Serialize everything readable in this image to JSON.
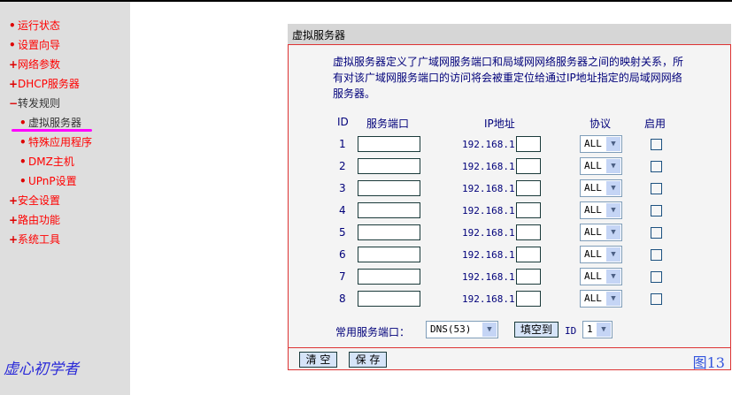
{
  "sidebar": {
    "items": [
      {
        "bullet": "•",
        "label": "运行状态"
      },
      {
        "bullet": "•",
        "label": "设置向导"
      },
      {
        "bullet": "+",
        "label": "网络参数"
      },
      {
        "bullet": "+",
        "label": "DHCP服务器"
      },
      {
        "bullet": "−",
        "label": "转发规则"
      },
      {
        "bullet": "•",
        "label": "虚拟服务器"
      },
      {
        "bullet": "•",
        "label": "特殊应用程序"
      },
      {
        "bullet": "•",
        "label": "DMZ主机"
      },
      {
        "bullet": "•",
        "label": "UPnP设置"
      },
      {
        "bullet": "+",
        "label": "安全设置"
      },
      {
        "bullet": "+",
        "label": "路由功能"
      },
      {
        "bullet": "+",
        "label": "系统工具"
      }
    ],
    "author": "虚心初学者"
  },
  "panel": {
    "title": "虚拟服务器",
    "description": "虚拟服务器定义了广域网服务端口和局域网网络服务器之间的映射关系，所有对该广域网服务端口的访问将会被重定位给通过IP地址指定的局域网网络服务器。",
    "headers": {
      "id": "ID",
      "port": "服务端口",
      "ip": "IP地址",
      "protocol": "协议",
      "enable": "启用"
    },
    "rows": [
      {
        "id": "1",
        "ip_prefix": "192.168.1.",
        "protocol": "ALL"
      },
      {
        "id": "2",
        "ip_prefix": "192.168.1.",
        "protocol": "ALL"
      },
      {
        "id": "3",
        "ip_prefix": "192.168.1.",
        "protocol": "ALL"
      },
      {
        "id": "4",
        "ip_prefix": "192.168.1.",
        "protocol": "ALL"
      },
      {
        "id": "5",
        "ip_prefix": "192.168.1.",
        "protocol": "ALL"
      },
      {
        "id": "6",
        "ip_prefix": "192.168.1.",
        "protocol": "ALL"
      },
      {
        "id": "7",
        "ip_prefix": "192.168.1.",
        "protocol": "ALL"
      },
      {
        "id": "8",
        "ip_prefix": "192.168.1.",
        "protocol": "ALL"
      }
    ],
    "common_port_label": "常用服务端口：",
    "common_port_value": "DNS(53)",
    "fill_button": "填空到",
    "id_label": "ID",
    "id_value": "1",
    "clear_button": "清 空",
    "save_button": "保 存",
    "figure_label": "图13"
  }
}
